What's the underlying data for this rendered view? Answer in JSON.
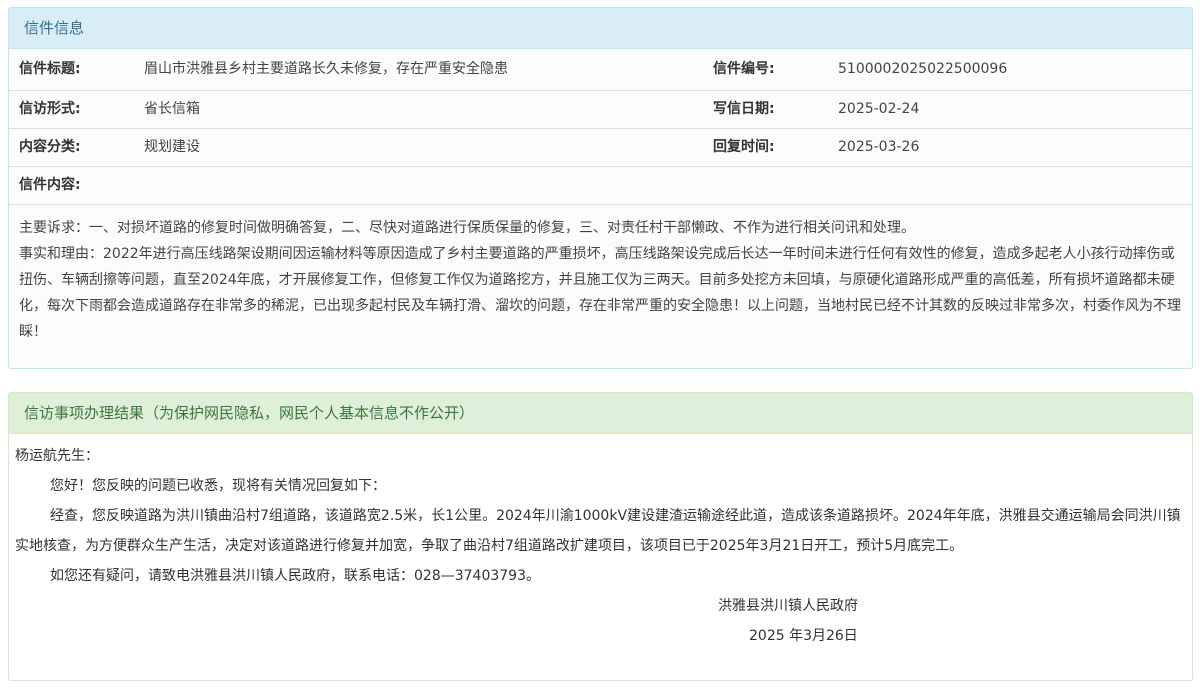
{
  "letter_info": {
    "heading": "信件信息",
    "title_label": "信件标题:",
    "title_value": "眉山市洪雅县乡村主要道路长久未修复，存在严重安全隐患",
    "number_label": "信件编号:",
    "number_value": "5100002025022500096",
    "form_label": "信访形式:",
    "form_value": "省长信箱",
    "write_date_label": "写信日期:",
    "write_date_value": "2025-02-24",
    "category_label": "内容分类:",
    "category_value": "规划建设",
    "reply_time_label": "回复时间:",
    "reply_time_value": "2025-03-26",
    "content_label": "信件内容:",
    "content_para1": "主要诉求：一、对损坏道路的修复时间做明确答复，二、尽快对道路进行保质保量的修复，三、对责任村干部懒政、不作为进行相关问讯和处理。",
    "content_para2": "事实和理由：2022年进行高压线路架设期间因运输材料等原因造成了乡村主要道路的严重损坏，高压线路架设完成后长达一年时间未进行任何有效性的修复，造成多起老人小孩行动摔伤或扭伤、车辆刮擦等问题，直至2024年底，才开展修复工作，但修复工作仅为道路挖方，并且施工仅为三两天。目前多处挖方未回填，与原硬化道路形成严重的高低差，所有损坏道路都未硬化，每次下雨都会造成道路存在非常多的稀泥，已出现多起村民及车辆打滑、溜坎的问题，存在非常严重的安全隐患！以上问题，当地村民已经不计其数的反映过非常多次，村委作风为不理睬！"
  },
  "result": {
    "heading": "信访事项办理结果（为保护网民隐私，网民个人基本信息不作公开）",
    "salutation": "杨运航先生：",
    "para1": "您好！您反映的问题已收悉，现将有关情况回复如下：",
    "para2": "经查，您反映道路为洪川镇曲沿村7组道路，该道路宽2.5米，长1公里。2024年川渝1000kV建设建渣运输途经此道，造成该条道路损坏。2024年年底，洪雅县交通运输局会同洪川镇实地核查，为方便群众生产生活，决定对该道路进行修复并加宽，争取了曲沿村7组道路改扩建项目，该项目已于2025年3月21日开工，预计5月底完工。",
    "para3": "如您还有疑问，请致电洪雅县洪川镇人民政府，联系电话：028—37403793。",
    "signature": "洪雅县洪川镇人民政府",
    "date": "2025 年3月26日"
  }
}
